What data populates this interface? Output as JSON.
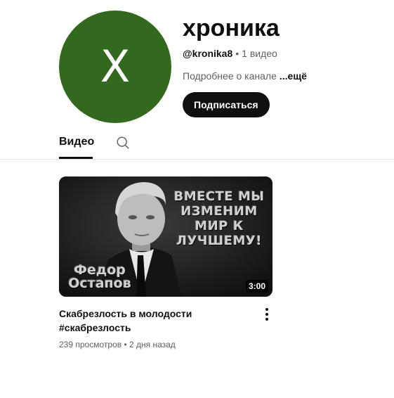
{
  "channel": {
    "avatar_letter": "X",
    "avatar_color": "#33691e",
    "name": "хроника",
    "handle": "@kronika8",
    "separator": "•",
    "video_count": "1 видео",
    "about": "Подробнее о канале",
    "more_label": "...ещё",
    "subscribe_label": "Подписаться"
  },
  "tabs": {
    "active": "Видео",
    "search_icon": "search-icon"
  },
  "video": {
    "thumbnail": {
      "slogan": "ВМЕСТЕ МЫ ИЗМЕНИМ МИР К ЛУЧШЕМУ!",
      "name_line1": "Федор",
      "name_line2": "Остапов"
    },
    "duration": "3:00",
    "title_line1": "Скабрезлость в молодости",
    "title_line2": "#скабрезлость",
    "views": "239 просмотров",
    "separator": "•",
    "age": "2 дня назад",
    "menu_icon": "more-vert-icon"
  }
}
